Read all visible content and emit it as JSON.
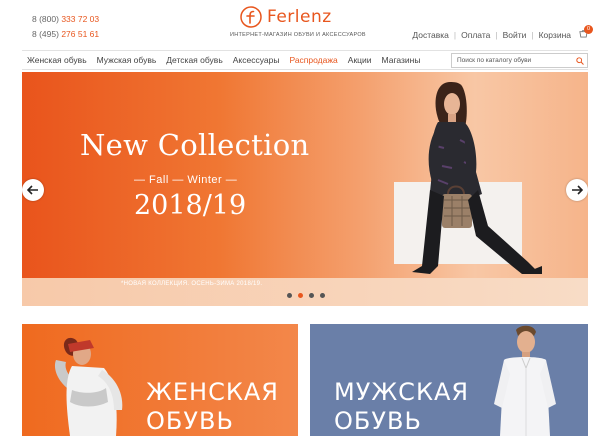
{
  "header": {
    "phones": [
      {
        "prefix": "8 (800)",
        "number": "333 72 03"
      },
      {
        "prefix": "8 (495)",
        "number": "276 51 61"
      }
    ],
    "logo_text": "Ferlenz",
    "tagline": "ИНТЕРНЕТ-МАГАЗИН ОБУВИ И АКСЕССУАРОВ",
    "links": [
      "Доставка",
      "Оплата",
      "Войти",
      "Корзина"
    ],
    "cart_count": "0"
  },
  "nav": {
    "items": [
      "Женская обувь",
      "Мужская обувь",
      "Детская обувь",
      "Аксессуары",
      "Распродажа",
      "Акции",
      "Магазины"
    ],
    "search_placeholder": "Поиск по каталогу обуви"
  },
  "hero": {
    "title": "New Collection",
    "subtitle": "— Fall — Winter —",
    "year": "2018/19",
    "caption": "*НОВАЯ КОЛЛЕКЦИЯ. ОСЕНЬ-ЗИМА 2018/19.",
    "slide_count": 4,
    "active_slide": 2
  },
  "tiles": {
    "women": {
      "line1": "ЖЕНСКАЯ",
      "line2": "ОБУВЬ"
    },
    "men": {
      "line1": "МУЖСКАЯ",
      "line2": "ОБУВЬ"
    }
  },
  "colors": {
    "accent": "#e8561e",
    "men_tile": "#6a7fa8"
  }
}
